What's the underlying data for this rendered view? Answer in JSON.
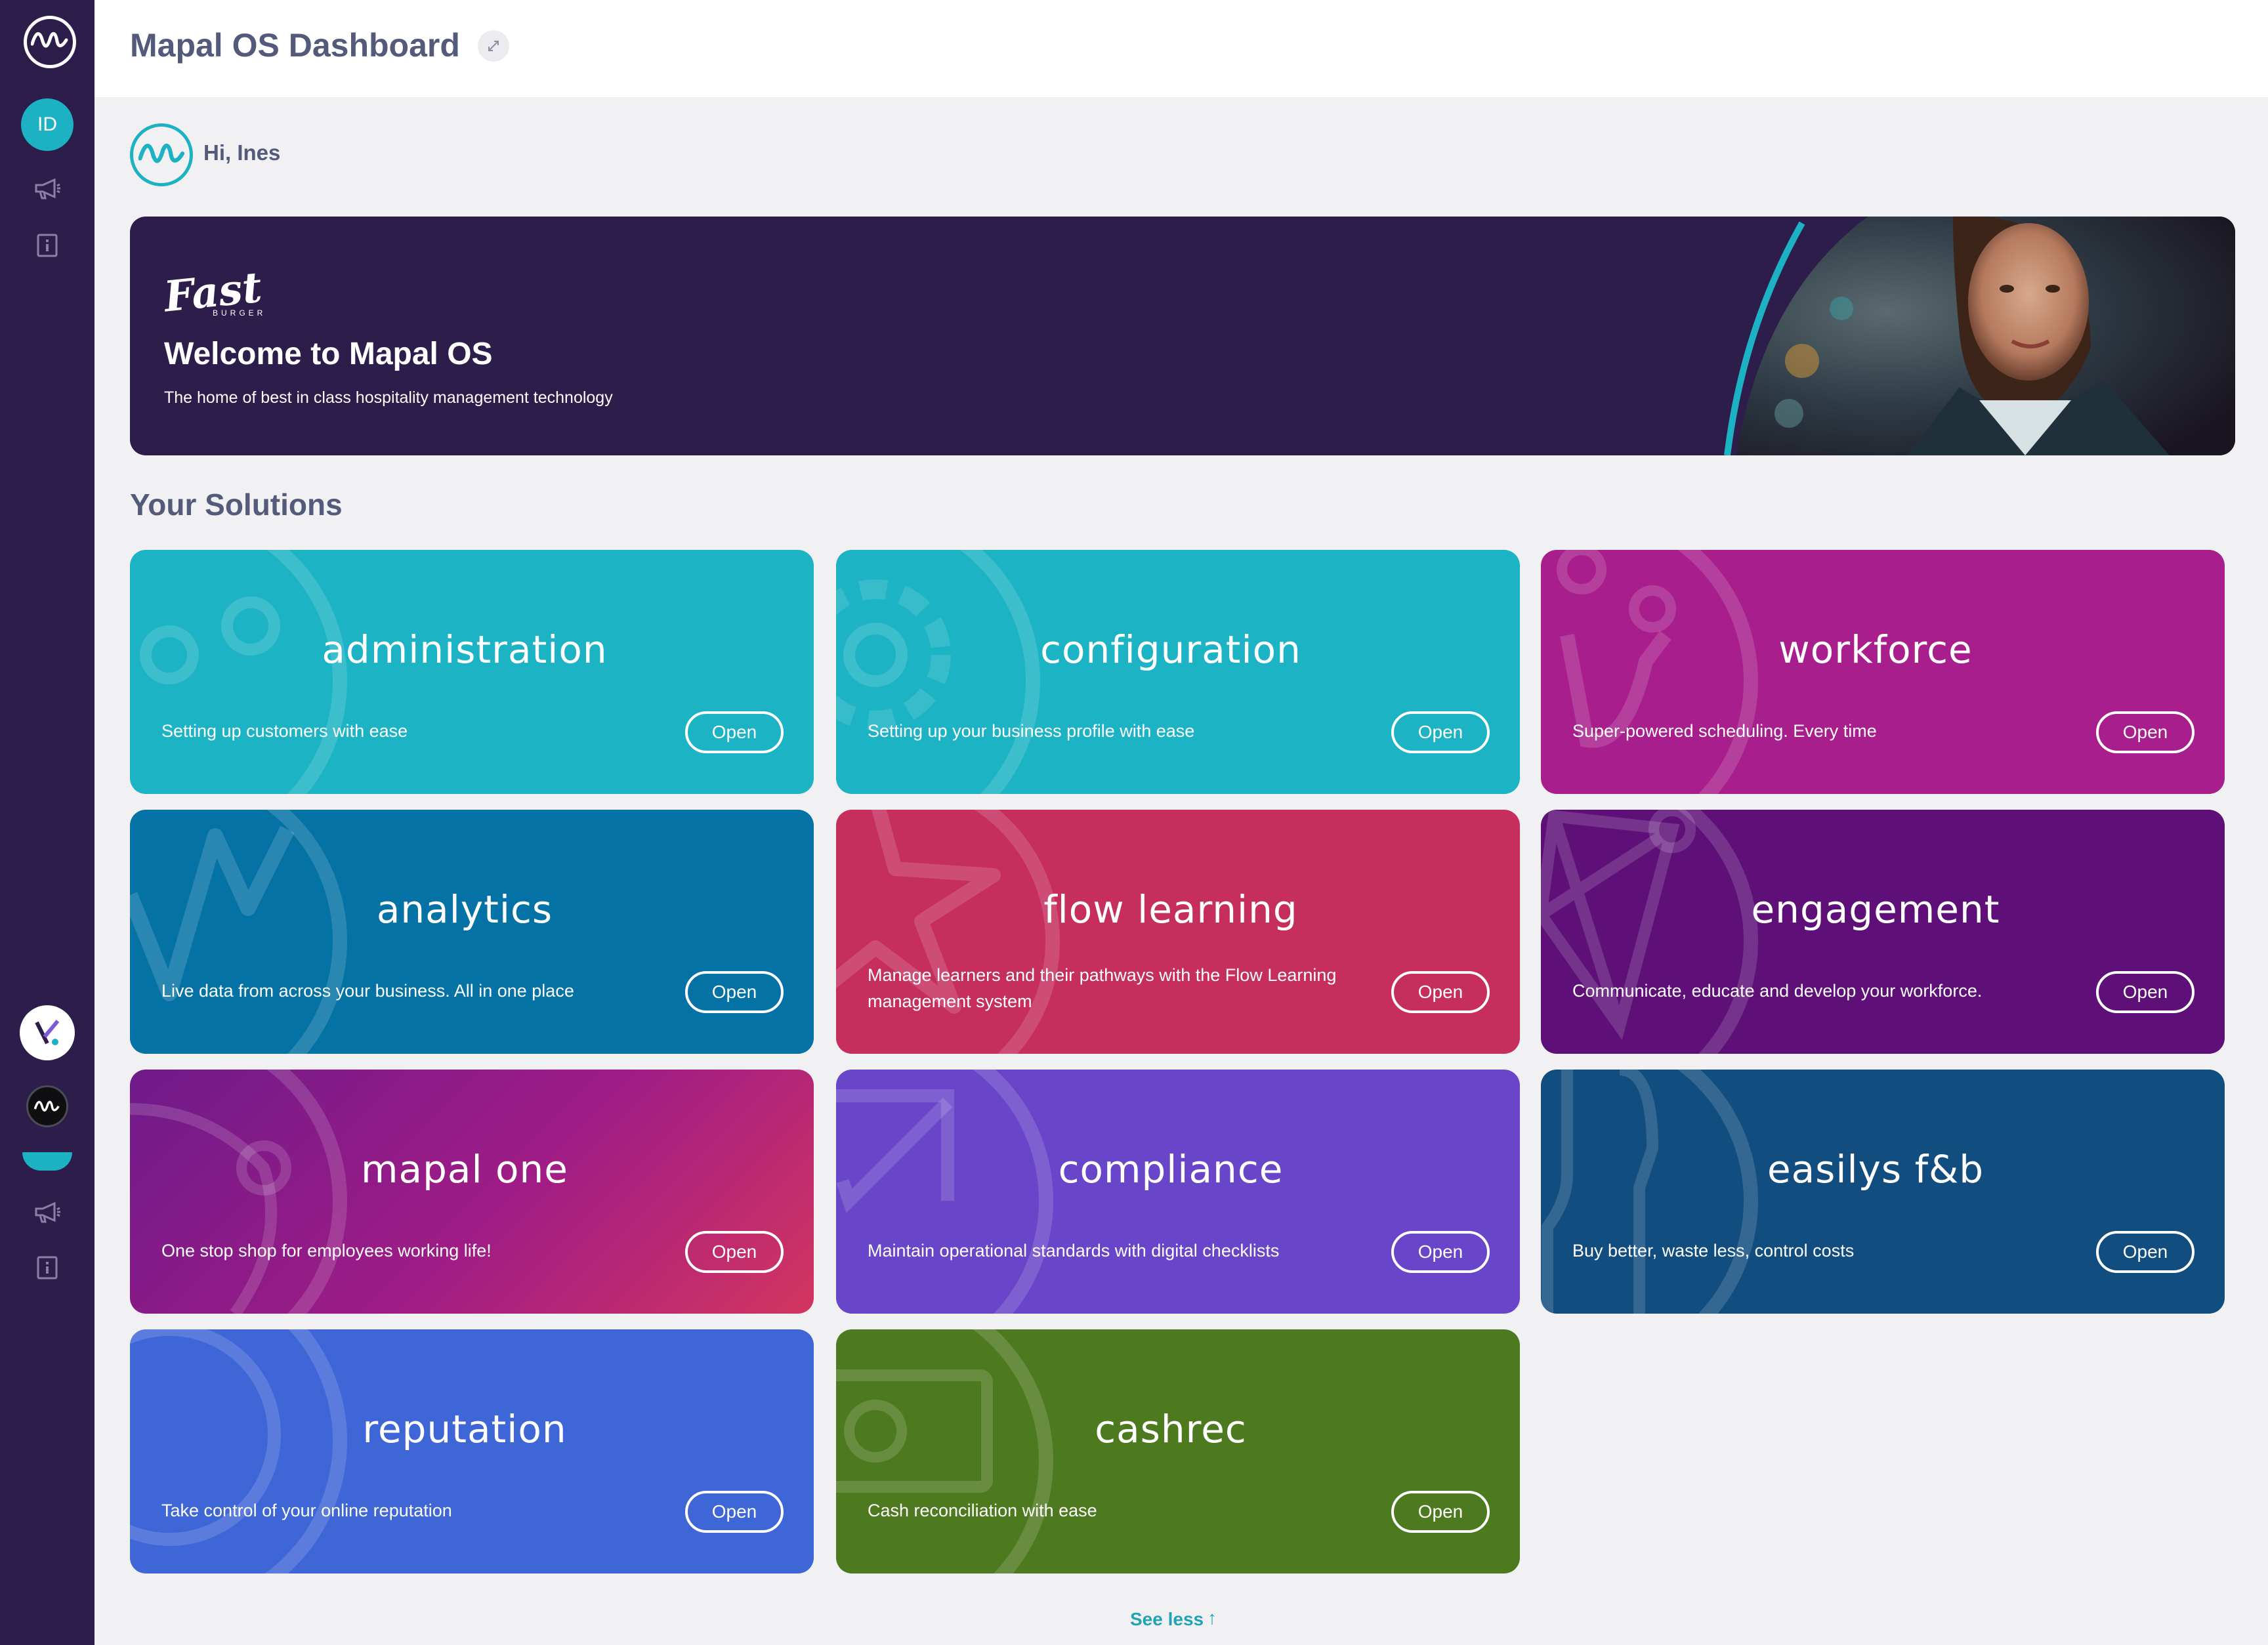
{
  "header": {
    "title": "Mapal OS Dashboard"
  },
  "greeting": "Hi, Ines",
  "user": {
    "initials": "ID"
  },
  "hero": {
    "brand": "Fast",
    "brand_sub": "BURGER",
    "title": "Welcome to Mapal OS",
    "subtitle": "The home of best in class hospitality management technology"
  },
  "solutions": {
    "heading": "Your Solutions",
    "open_label": "Open",
    "cards": [
      {
        "title": "administration",
        "description": "Setting up customers with ease",
        "color": "#1cb3c4"
      },
      {
        "title": "configuration",
        "description": "Setting up your business profile with ease",
        "color": "#1cb3c4"
      },
      {
        "title": "workforce",
        "description": "Super-powered scheduling. Every time",
        "color": "#a81e8c"
      },
      {
        "title": "analytics",
        "description": "Live data from across your business. All in one place",
        "color": "#0572a5"
      },
      {
        "title": "flow learning",
        "description": "Manage learners and their pathways with the Flow Learning management system",
        "color": "#c62e5e"
      },
      {
        "title": "engagement",
        "description": "Communicate, educate and develop your workforce.",
        "color": "#5e1078"
      },
      {
        "title": "mapal one",
        "description": "One stop shop for employees working life!",
        "color": "#9b1e86"
      },
      {
        "title": "compliance",
        "description": "Maintain operational standards with digital checklists",
        "color": "#6945c9"
      },
      {
        "title": "easilys f&b",
        "description": "Buy better, waste less, control costs",
        "color": "#124d80"
      },
      {
        "title": "reputation",
        "description": "Take control of your online reputation",
        "color": "#3f66d6"
      },
      {
        "title": "cashrec",
        "description": "Cash reconciliation with ease",
        "color": "#4e7a1f"
      }
    ]
  },
  "see_less": "See less",
  "icons": {
    "announcements": "megaphone-icon",
    "info": "info-icon",
    "see_less": "arrow-up-icon",
    "expand": "expand-icon"
  }
}
